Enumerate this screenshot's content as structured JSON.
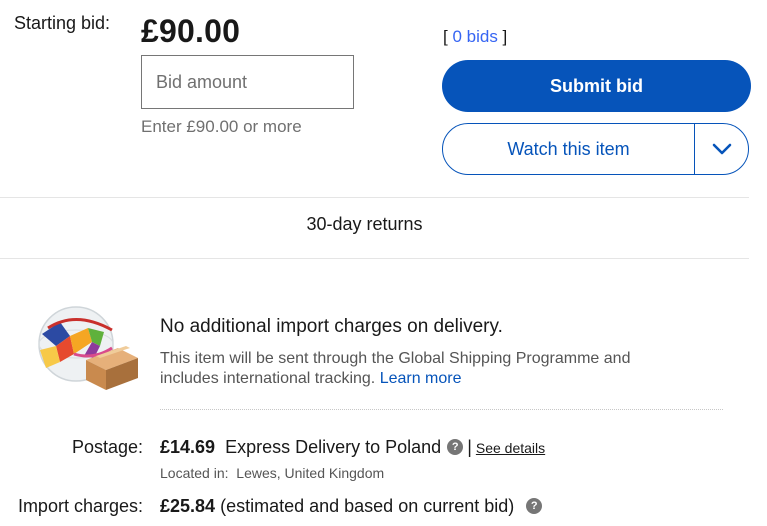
{
  "bid": {
    "starting_label": "Starting bid:",
    "price": "£90.00",
    "bids_open": "[ ",
    "bids_link": "0 bids",
    "bids_close": " ]",
    "input_placeholder": "Bid amount",
    "hint": "Enter £90.00 or more",
    "submit_label": "Submit bid",
    "watch_label": "Watch this item"
  },
  "returns": {
    "label": "30-day returns"
  },
  "import": {
    "title": "No additional import charges on delivery.",
    "description": "This item will be sent through the Global Shipping Programme and includes international tracking.",
    "learn_more": "Learn more",
    "icon": "global-shipping-globe-box-icon"
  },
  "postage": {
    "label": "Postage:",
    "price": "£14.69",
    "method": "Express Delivery to Poland",
    "separator": "|",
    "see_details": "See details",
    "located_label": "Located in:",
    "located_value": "Lewes, United Kingdom"
  },
  "import_charges": {
    "label": "Import charges:",
    "price": "£25.84",
    "note": "(estimated and based on current bid)"
  },
  "colors": {
    "primary": "#0654ba",
    "link": "#3665f3",
    "text": "#191919",
    "muted": "#707070"
  }
}
